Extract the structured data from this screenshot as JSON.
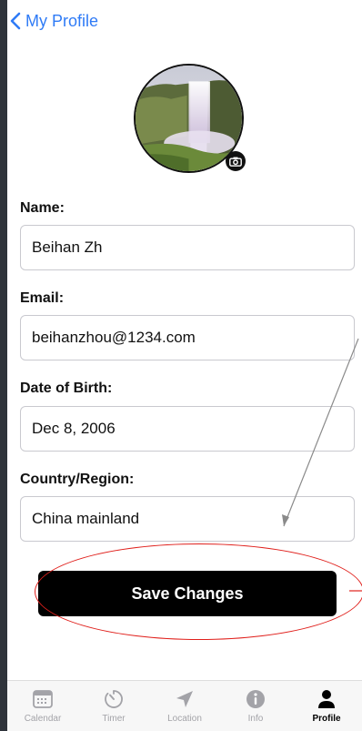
{
  "header": {
    "back_label": "My Profile"
  },
  "form": {
    "name_label": "Name:",
    "name_value": "Beihan Zh",
    "email_label": "Email:",
    "email_value": "beihanzhou@1234.com",
    "dob_label": "Date of Birth:",
    "dob_value": "Dec 8, 2006",
    "country_label": "Country/Region:",
    "country_value": "China mainland",
    "save_label": "Save Changes"
  },
  "tabs": [
    {
      "label": "Calendar",
      "icon": "calendar-icon"
    },
    {
      "label": "Timer",
      "icon": "timer-icon"
    },
    {
      "label": "Location",
      "icon": "location-arrow-icon"
    },
    {
      "label": "Info",
      "icon": "info-icon"
    },
    {
      "label": "Profile",
      "icon": "person-icon",
      "active": true
    }
  ],
  "colors": {
    "accent": "#2f7bf6",
    "annotation": "#e0201c",
    "button": "#000000"
  }
}
